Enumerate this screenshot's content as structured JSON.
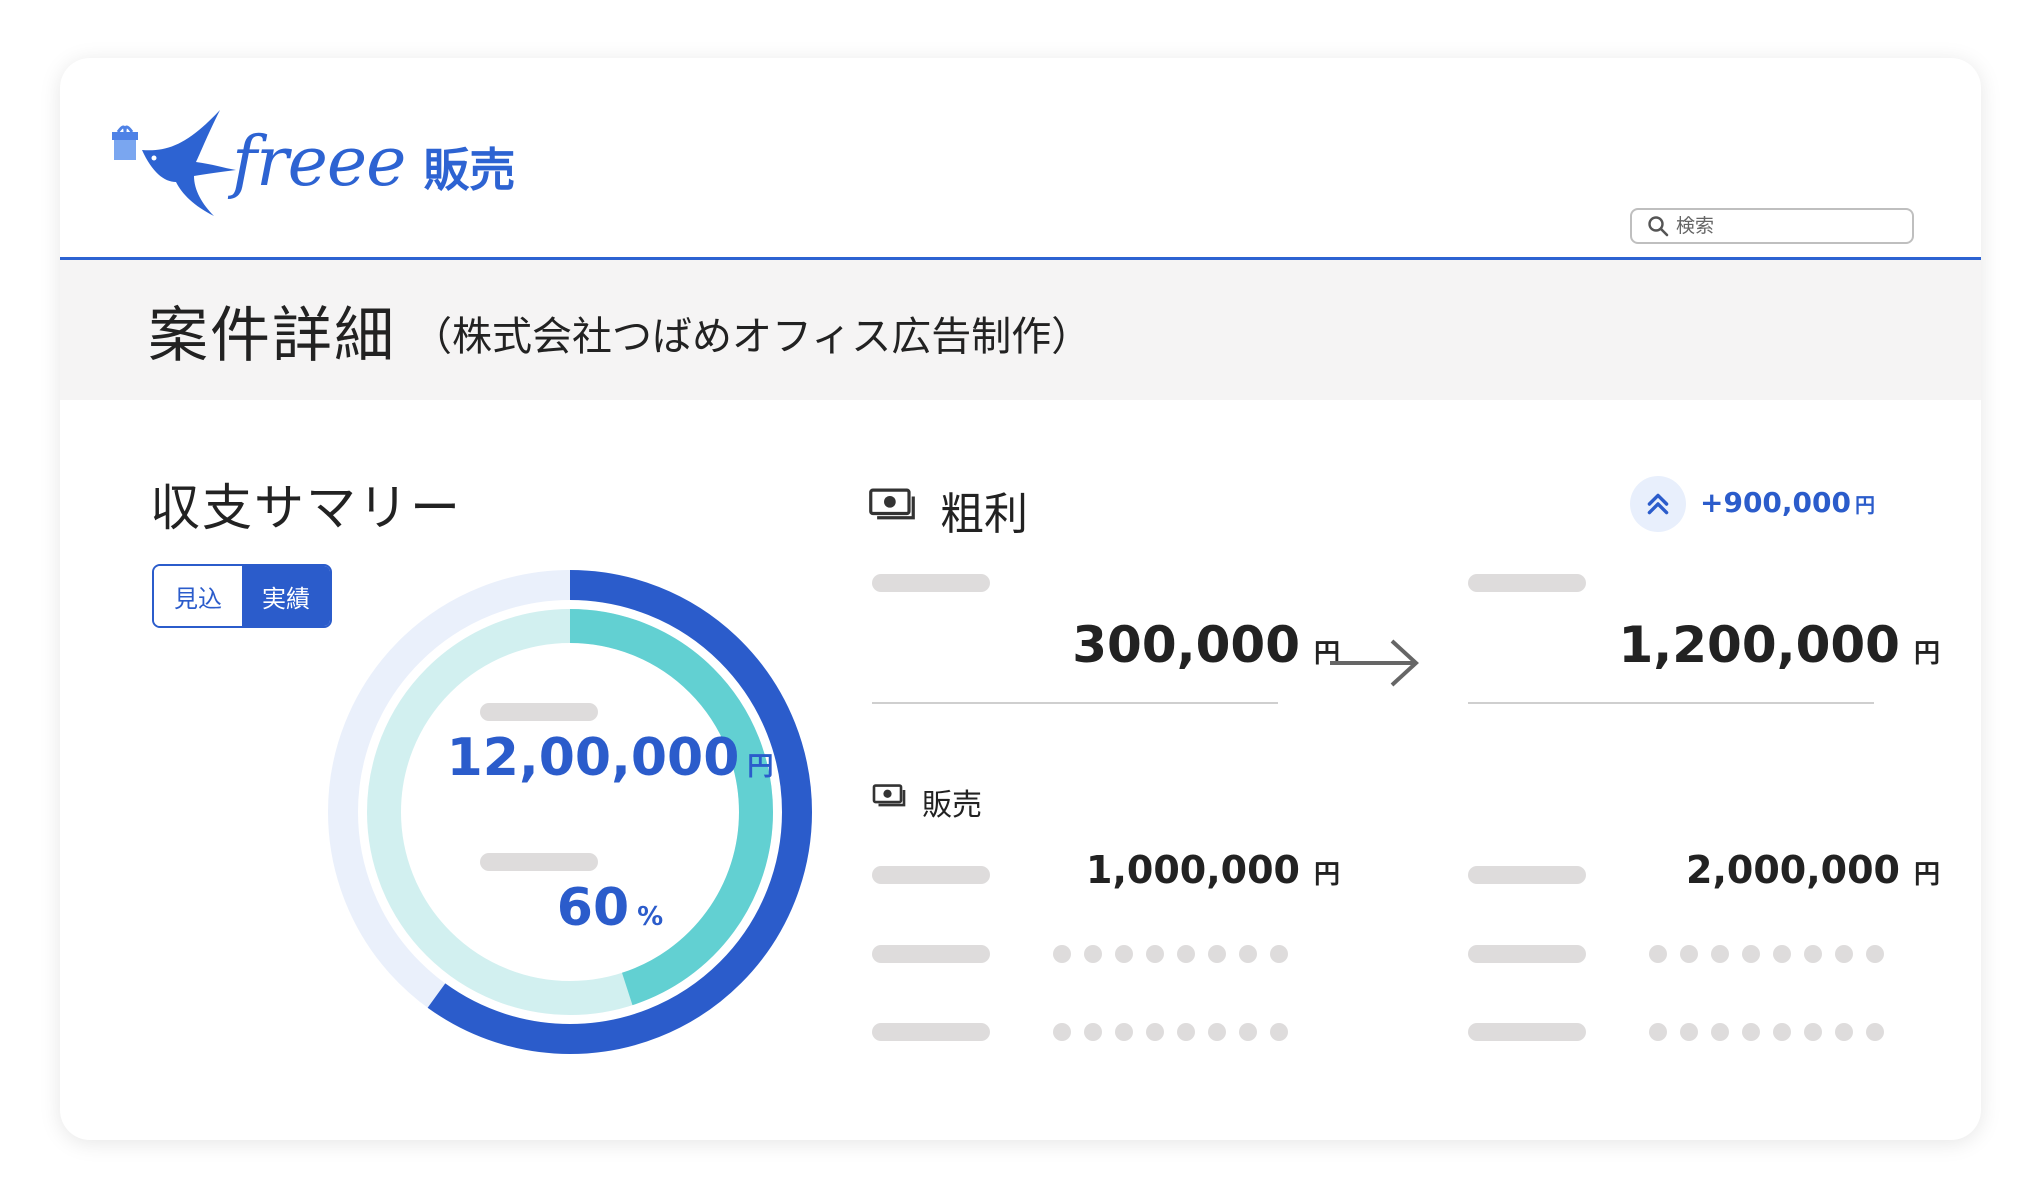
{
  "app": {
    "logo_word": "freee",
    "logo_sub": "販売",
    "accent_color": "#2d63d2"
  },
  "search": {
    "placeholder": "検索",
    "icon": "magnifier-icon"
  },
  "page": {
    "title": "案件詳細",
    "subtitle": "（株式会社つばめオフィス広告制作）"
  },
  "summary": {
    "title": "収支サマリー",
    "toggle": {
      "options": [
        "見込",
        "実績"
      ],
      "selected": "実績"
    },
    "total_value": "12,00,000",
    "total_unit": "円",
    "ratio_value": "60",
    "ratio_unit": "%",
    "outer_ring_fraction": 0.6,
    "inner_ring_fraction": 0.45,
    "colors": {
      "outer": "#2b5ccb",
      "outer_track": "#eaf0fb",
      "inner": "#62d0d2",
      "inner_track": "#d2f0f0"
    }
  },
  "gross_profit": {
    "label": "粗利",
    "icon": "money-icon",
    "diff_icon": "double-chevron-up-icon",
    "diff_value": "+900,000",
    "diff_unit": "円",
    "before_value": "300,000",
    "after_value": "1,200,000",
    "unit": "円"
  },
  "sales": {
    "label": "販売",
    "icon": "money-icon",
    "before_value": "1,000,000",
    "after_value": "2,000,000",
    "unit": "円"
  }
}
